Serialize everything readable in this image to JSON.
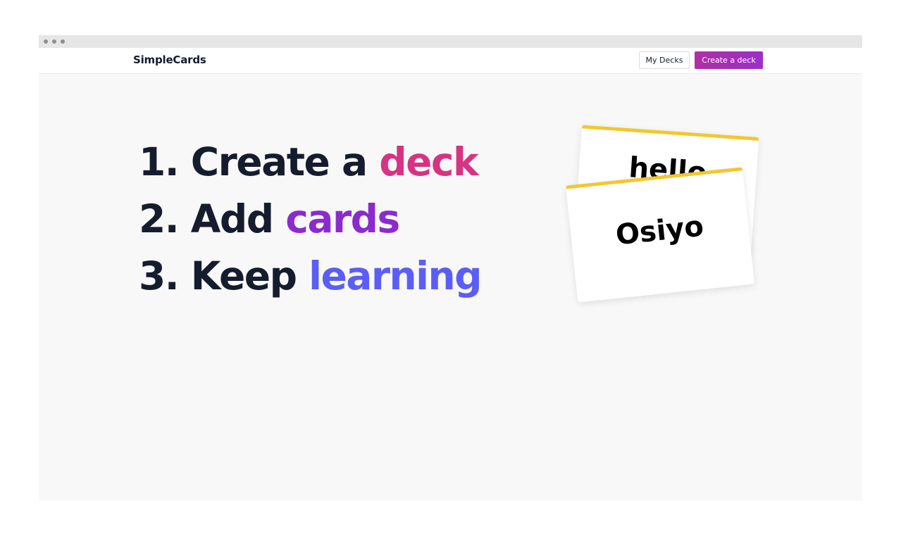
{
  "brand": "SimpleCards",
  "nav": {
    "my_decks": "My Decks",
    "create_deck": "Create a deck"
  },
  "steps": [
    {
      "prefix": "1. Create a ",
      "highlight": "deck",
      "color": "#d63383"
    },
    {
      "prefix": "2. Add ",
      "highlight": "cards",
      "color": "#8b2bce"
    },
    {
      "prefix": "3. Keep ",
      "highlight": "learning",
      "color": "#5b5ef5"
    }
  ],
  "cards": {
    "back_word": "hello",
    "front_word": "Osiyo",
    "accent": "#f3c72d"
  },
  "colors": {
    "text_dark": "#141c2e",
    "button_accent": "#b22ea6"
  }
}
